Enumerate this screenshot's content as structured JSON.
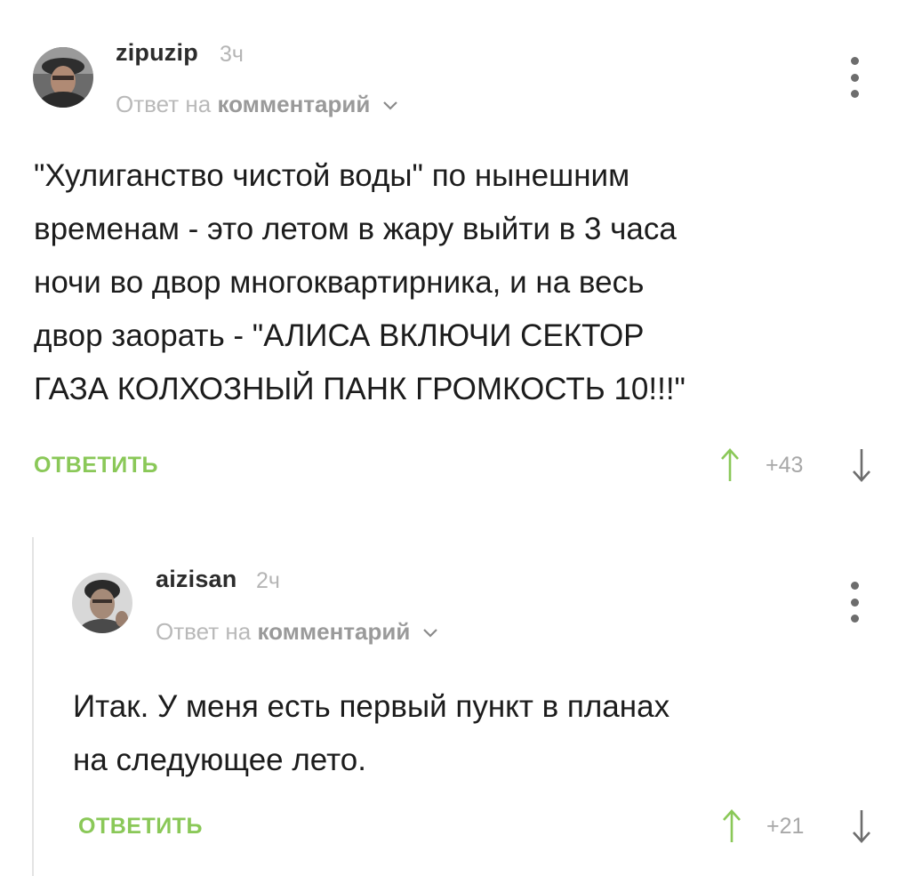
{
  "comments": [
    {
      "username": "zipuzip",
      "time": "3ч",
      "reply_prefix": "Ответ на",
      "reply_target": "комментарий",
      "body_lines": [
        "\"Хулиганство чистой воды\" по нынешним",
        "временам - это летом в жару выйти в 3 часа",
        "ночи во двор многоквартирника, и на весь",
        "двор заорать - \"АЛИСА ВКЛЮЧИ СЕКТОР",
        "ГАЗА КОЛХОЗНЫЙ ПАНК ГРОМКОСТЬ 10!!!\""
      ],
      "reply_label": "ОТВЕТИТЬ",
      "rating": "+43",
      "avatar_icon": "user-avatar-icon"
    },
    {
      "username": "aizisan",
      "time": "2ч",
      "reply_prefix": "Ответ на",
      "reply_target": "комментарий",
      "body_lines": [
        "Итак. У меня есть первый пункт в планах",
        "на следующее лето."
      ],
      "reply_label": "ОТВЕТИТЬ",
      "rating": "+21",
      "avatar_icon": "user-avatar-icon"
    }
  ],
  "colors": {
    "reply_button": "#8ac858",
    "vote_up": "#8ac858",
    "vote_down": "#6d6d6d",
    "muted_text": "#b5b5b5",
    "thread_line": "#e3e3e3"
  }
}
